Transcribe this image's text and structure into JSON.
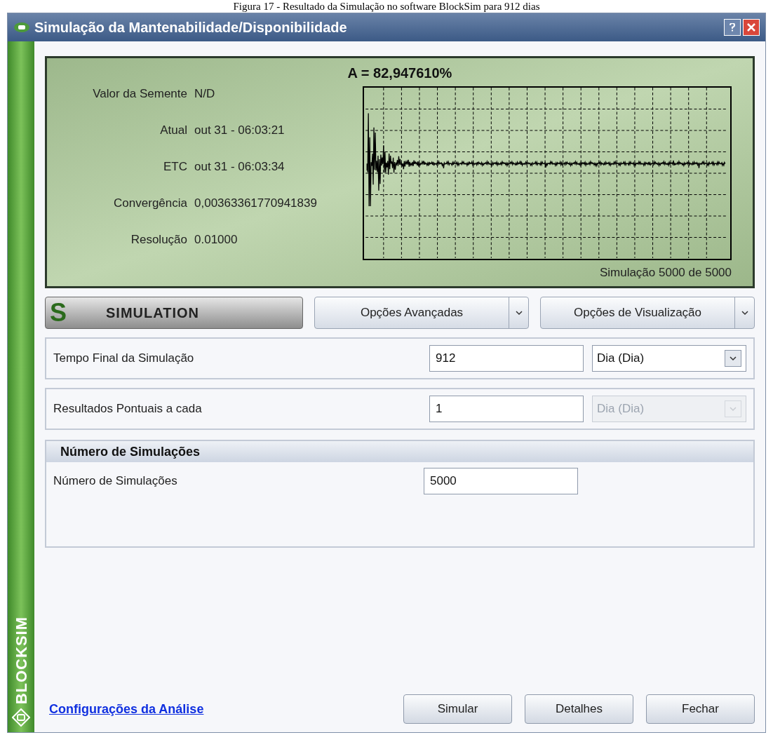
{
  "caption": "Figura 17 - Resultado da Simulação no software BlockSim para 912 dias",
  "window": {
    "title": "Simulação da Mantenabilidade/Disponibilidade"
  },
  "sidebar": {
    "brand": "BLOCKSIM"
  },
  "status_panel": {
    "headline": "A = 82,947610%",
    "fields": [
      {
        "label": "Valor da Semente",
        "value": "N/D"
      },
      {
        "label": "Atual",
        "value": "out 31 - 06:03:21"
      },
      {
        "label": "ETC",
        "value": "out 31 - 06:03:34"
      },
      {
        "label": "Convergência",
        "value": "0,00363361770941839"
      },
      {
        "label": "Resolução",
        "value": "0.01000"
      }
    ],
    "progress": "Simulação 5000 de 5000"
  },
  "toolbar": {
    "logo_letter": "S",
    "logo_text": "SIMULATION",
    "menus": [
      "Opções Avançadas",
      "Opções de Visualização"
    ]
  },
  "settings": [
    {
      "label": "Tempo Final da Simulação",
      "value": "912",
      "unit": "Dia (Dia)",
      "disabled": false
    },
    {
      "label": "Resultados Pontuais a cada",
      "value": "1",
      "unit": "Dia (Dia)",
      "disabled": true
    }
  ],
  "section": {
    "title": "Número de Simulações",
    "fields": [
      {
        "label": "Número de Simulações",
        "value": "5000"
      }
    ]
  },
  "link": "Configurações da Análise",
  "buttons": [
    "Simular",
    "Detalhes",
    "Fechar"
  ]
}
